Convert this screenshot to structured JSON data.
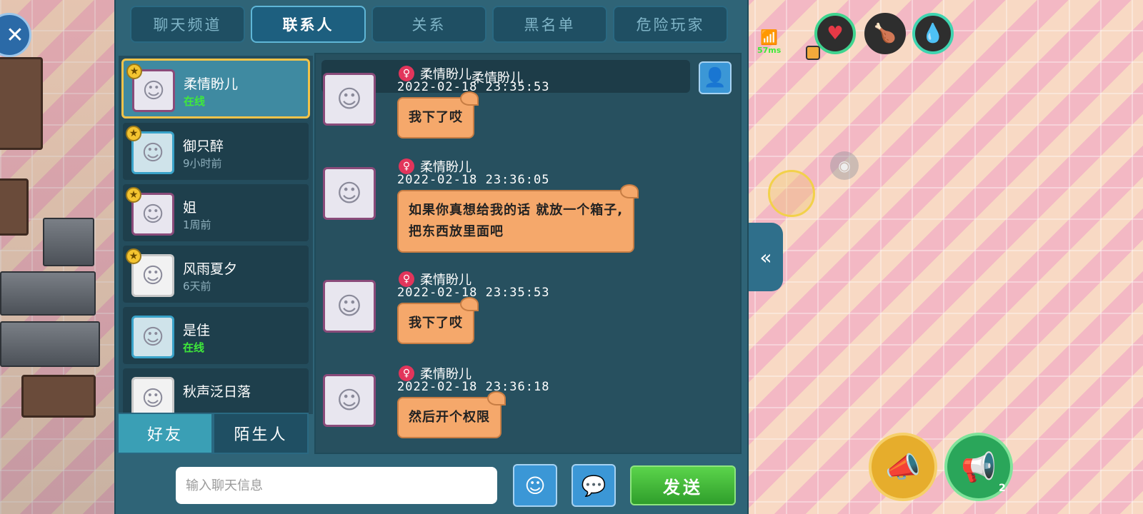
{
  "tabs": [
    "聊天频道",
    "联系人",
    "关系",
    "黑名单",
    "危险玩家"
  ],
  "contacts": [
    {
      "name": "柔情盼儿",
      "status": "在线",
      "online": true,
      "starred": true,
      "active": true
    },
    {
      "name": "御只醉",
      "status": "9小时前",
      "online": false,
      "starred": true,
      "active": false
    },
    {
      "name": "姐",
      "status": "1周前",
      "online": false,
      "starred": true,
      "active": false
    },
    {
      "name": "风雨夏夕",
      "status": "6天前",
      "online": false,
      "starred": true,
      "active": false
    },
    {
      "name": "是佳",
      "status": "在线",
      "online": true,
      "starred": false,
      "active": false
    },
    {
      "name": "秋声泛日落",
      "status": "",
      "online": false,
      "starred": false,
      "active": false
    }
  ],
  "bottom_tabs": [
    "好友",
    "陌生人"
  ],
  "chat": {
    "header_name": "柔情盼儿",
    "messages": [
      {
        "sender": "柔情盼儿",
        "time": "2022-02-18  23:35:53",
        "lines": [
          "我下了哎"
        ]
      },
      {
        "sender": "柔情盼儿",
        "time": "2022-02-18  23:36:05",
        "lines": [
          "如果你真想给我的话 就放一个箱子,",
          "把东西放里面吧"
        ]
      },
      {
        "sender": "柔情盼儿",
        "time": "2022-02-18  23:35:53",
        "lines": [
          "我下了哎"
        ]
      },
      {
        "sender": "柔情盼儿",
        "time": "2022-02-18  23:36:18",
        "lines": [
          "然后开个权限"
        ]
      }
    ]
  },
  "input": {
    "placeholder": "输入聊天信息",
    "value": ""
  },
  "send_label": "发送",
  "hud": {
    "ping": "57ms",
    "horn_count": "2"
  },
  "icons": {
    "close": "close-icon",
    "profile": "user-icon",
    "emoji": "smiley-icon",
    "bubble": "speech-bubble-icon",
    "collapse": "double-chevron-left-icon",
    "heart": "heart-icon",
    "food": "food-icon",
    "water": "water-drop-icon",
    "horn": "megaphone-icon",
    "gender": "female-icon",
    "star": "star-icon",
    "eye": "eye-icon"
  },
  "colors": {
    "panel": "#2f6477",
    "bubble": "#f5a86b",
    "online": "#3fea3a",
    "send": "#3fb63a",
    "highlight": "#f2c34a"
  }
}
